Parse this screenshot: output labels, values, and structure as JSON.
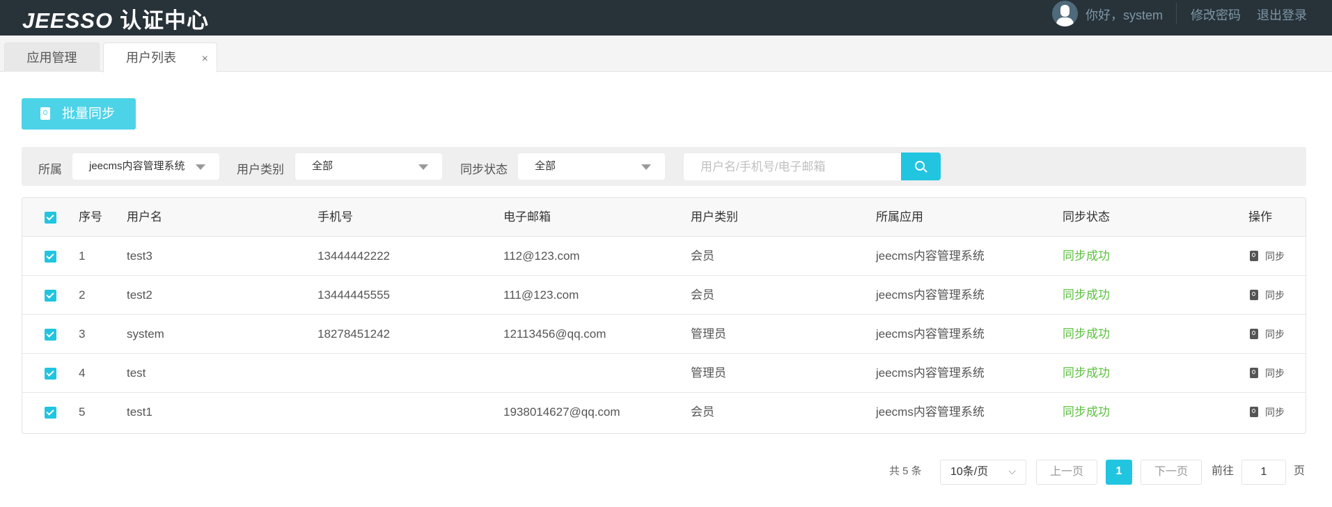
{
  "header": {
    "logo_latin": "JEESSO",
    "logo_cn": "认证中心",
    "greeting": "你好，system",
    "change_password": "修改密码",
    "logout": "退出登录"
  },
  "tabs": [
    {
      "label": "应用管理"
    },
    {
      "label": "用户列表",
      "close": "×"
    }
  ],
  "toolbar": {
    "batch_sync": "批量同步"
  },
  "filters": {
    "app_label": "所属",
    "app_value": "jeecms内容管理系统",
    "type_label": "用户类别",
    "type_value": "全部",
    "status_label": "同步状态",
    "status_value": "全部",
    "search_placeholder": "用户名/手机号/电子邮箱"
  },
  "table": {
    "headers": [
      "序号",
      "用户名",
      "手机号",
      "电子邮箱",
      "用户类别",
      "所属应用",
      "同步状态",
      "操作"
    ],
    "rows": [
      {
        "no": "1",
        "username": "test3",
        "phone": "13444442222",
        "email": "112@123.com",
        "type": "会员",
        "app": "jeecms内容管理系统",
        "status": "同步成功",
        "action": "同步"
      },
      {
        "no": "2",
        "username": "test2",
        "phone": "13444445555",
        "email": "111@123.com",
        "type": "会员",
        "app": "jeecms内容管理系统",
        "status": "同步成功",
        "action": "同步"
      },
      {
        "no": "3",
        "username": "system",
        "phone": "18278451242",
        "email": "12113456@qq.com",
        "type": "管理员",
        "app": "jeecms内容管理系统",
        "status": "同步成功",
        "action": "同步"
      },
      {
        "no": "4",
        "username": "test",
        "phone": "",
        "email": "",
        "type": "管理员",
        "app": "jeecms内容管理系统",
        "status": "同步成功",
        "action": "同步"
      },
      {
        "no": "5",
        "username": "test1",
        "phone": "",
        "email": "1938014627@qq.com",
        "type": "会员",
        "app": "jeecms内容管理系统",
        "status": "同步成功",
        "action": "同步"
      }
    ]
  },
  "pagination": {
    "total": "共 5 条",
    "page_size": "10条/页",
    "prev": "上一页",
    "current": "1",
    "next": "下一页",
    "goto_label": "前往",
    "goto_value": "1",
    "page_suffix": "页"
  },
  "colors": {
    "header_bg": "#283239",
    "accent": "#22c5e0",
    "success": "#5cc040"
  }
}
